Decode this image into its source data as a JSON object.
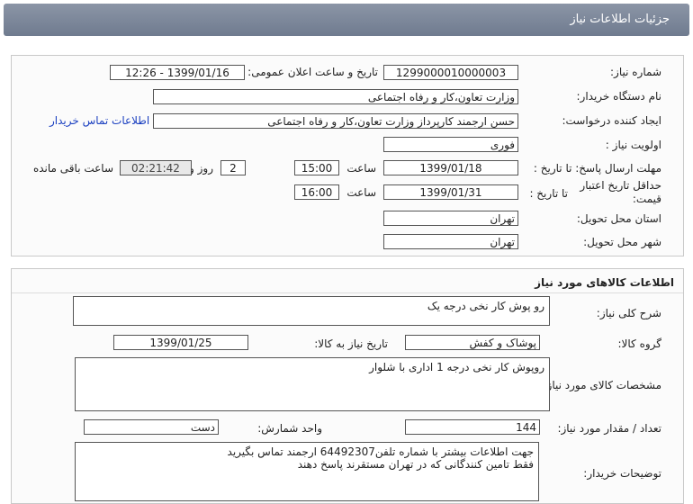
{
  "header": {
    "title": "جزئیات اطلاعات نیاز"
  },
  "need": {
    "number_label": "شماره نیاز:",
    "number": "1299000010000003",
    "announce_label": "تاریخ و ساعت اعلان عمومی:",
    "announce": "1399/01/16 - 12:26",
    "buyer_org_label": "نام دستگاه خریدار:",
    "buyer_org": "وزارت تعاون،کار و رفاه اجتماعی",
    "creator_label": "ایجاد کننده درخواست:",
    "creator": "حسن ارجمند کارپرداز وزارت تعاون،کار و رفاه اجتماعی",
    "contact_link": "اطلاعات تماس خریدار",
    "priority_label": "اولویت نیاز :",
    "priority": "فوری",
    "reply_label": "مهلت ارسال پاسخ:  تا تاریخ :",
    "reply_date": "1399/01/18",
    "time_label": "ساعت",
    "reply_time": "15:00",
    "days": "2",
    "days_label": "روز و",
    "remaining": "02:21:42",
    "remaining_label": "ساعت باقی مانده",
    "validity_label_1": "حداقل تاریخ اعتبار",
    "validity_label_2": "قیمت:",
    "validity_to_label": "تا تاریخ :",
    "validity_date": "1399/01/31",
    "validity_time": "16:00",
    "province_label": "استان محل تحویل:",
    "province": "تهران",
    "city_label": "شهر محل تحویل:",
    "city": "تهران"
  },
  "goods": {
    "title": "اطلاعات کالاهای مورد نیاز",
    "summary_label": "شرح کلی نیاز:",
    "summary": "رو پوش کار نخی درجه یک",
    "group_label": "گروه کالا:",
    "group": "پوشاک و کفش",
    "need_date_label": "تاریخ نیاز به کالا:",
    "need_date": "1399/01/25",
    "specs_label": "مشخصات کالای مورد نیاز:",
    "specs": "روپوش کار نخی درجه 1 اداری  با شلوار",
    "qty_label": "تعداد / مقدار مورد نیاز:",
    "qty": "144",
    "unit_label": "واحد شمارش:",
    "unit": "دست",
    "buyer_notes_label": "توضیحات خریدار:",
    "buyer_notes_1": "جهت اطلاعات بیشتر با شماره تلفن64492307 ارجمند تماس بگیرید",
    "buyer_notes_2": "فقط تامین کنندگانی که در تهران مستقرند پاسخ دهند"
  }
}
